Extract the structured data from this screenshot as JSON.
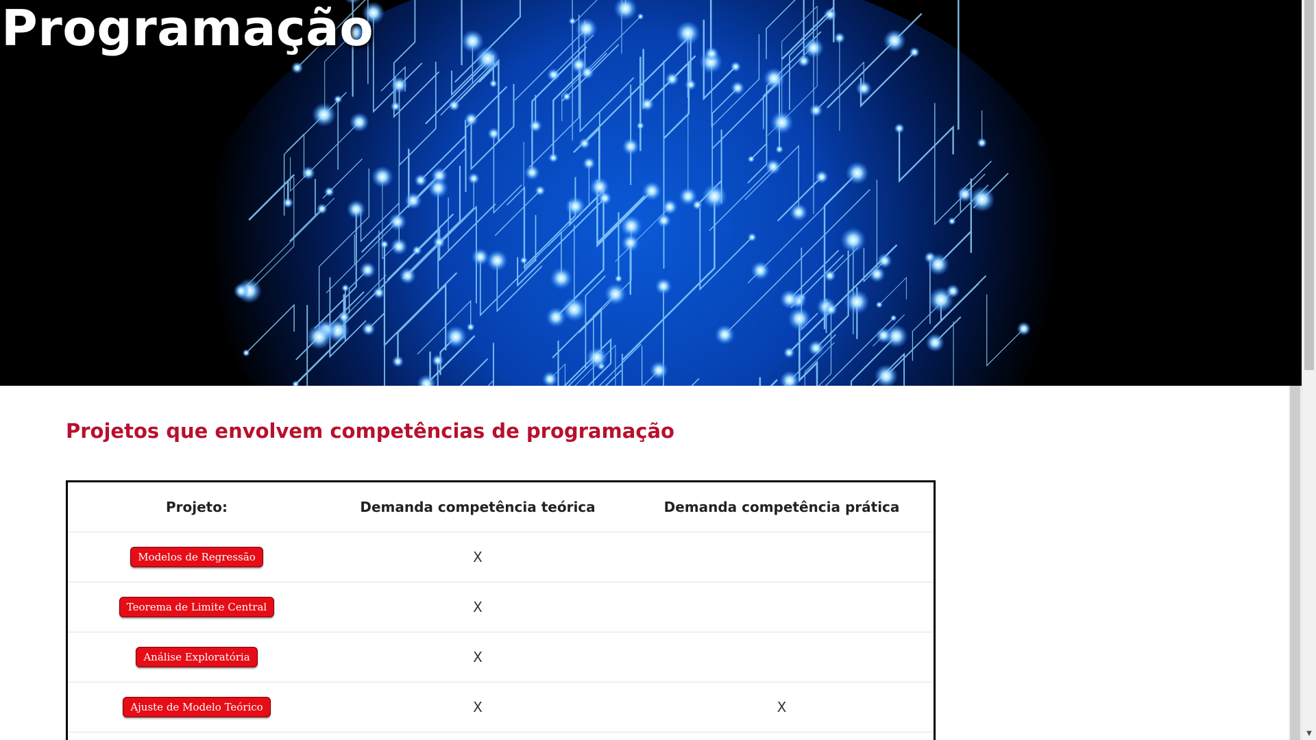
{
  "hero": {
    "title": "Programação"
  },
  "section": {
    "title": "Projetos que envolvem competências de programação"
  },
  "table": {
    "headers": [
      "Projeto:",
      "Demanda competência teórica",
      "Demanda competência prática"
    ],
    "rows": [
      {
        "project": "Modelos de Regressão",
        "theoretical": "X",
        "practical": ""
      },
      {
        "project": "Teorema de Limite Central",
        "theoretical": "X",
        "practical": ""
      },
      {
        "project": "Análise Exploratória",
        "theoretical": "X",
        "practical": ""
      },
      {
        "project": "Ajuste de Modelo Teórico",
        "theoretical": "X",
        "practical": "X"
      }
    ]
  },
  "colors": {
    "accent": "#b8102e",
    "button": "#e60d17",
    "hero_glow": "#1e7bff"
  },
  "icons": {
    "scroll_down": "chevron-down-icon"
  }
}
